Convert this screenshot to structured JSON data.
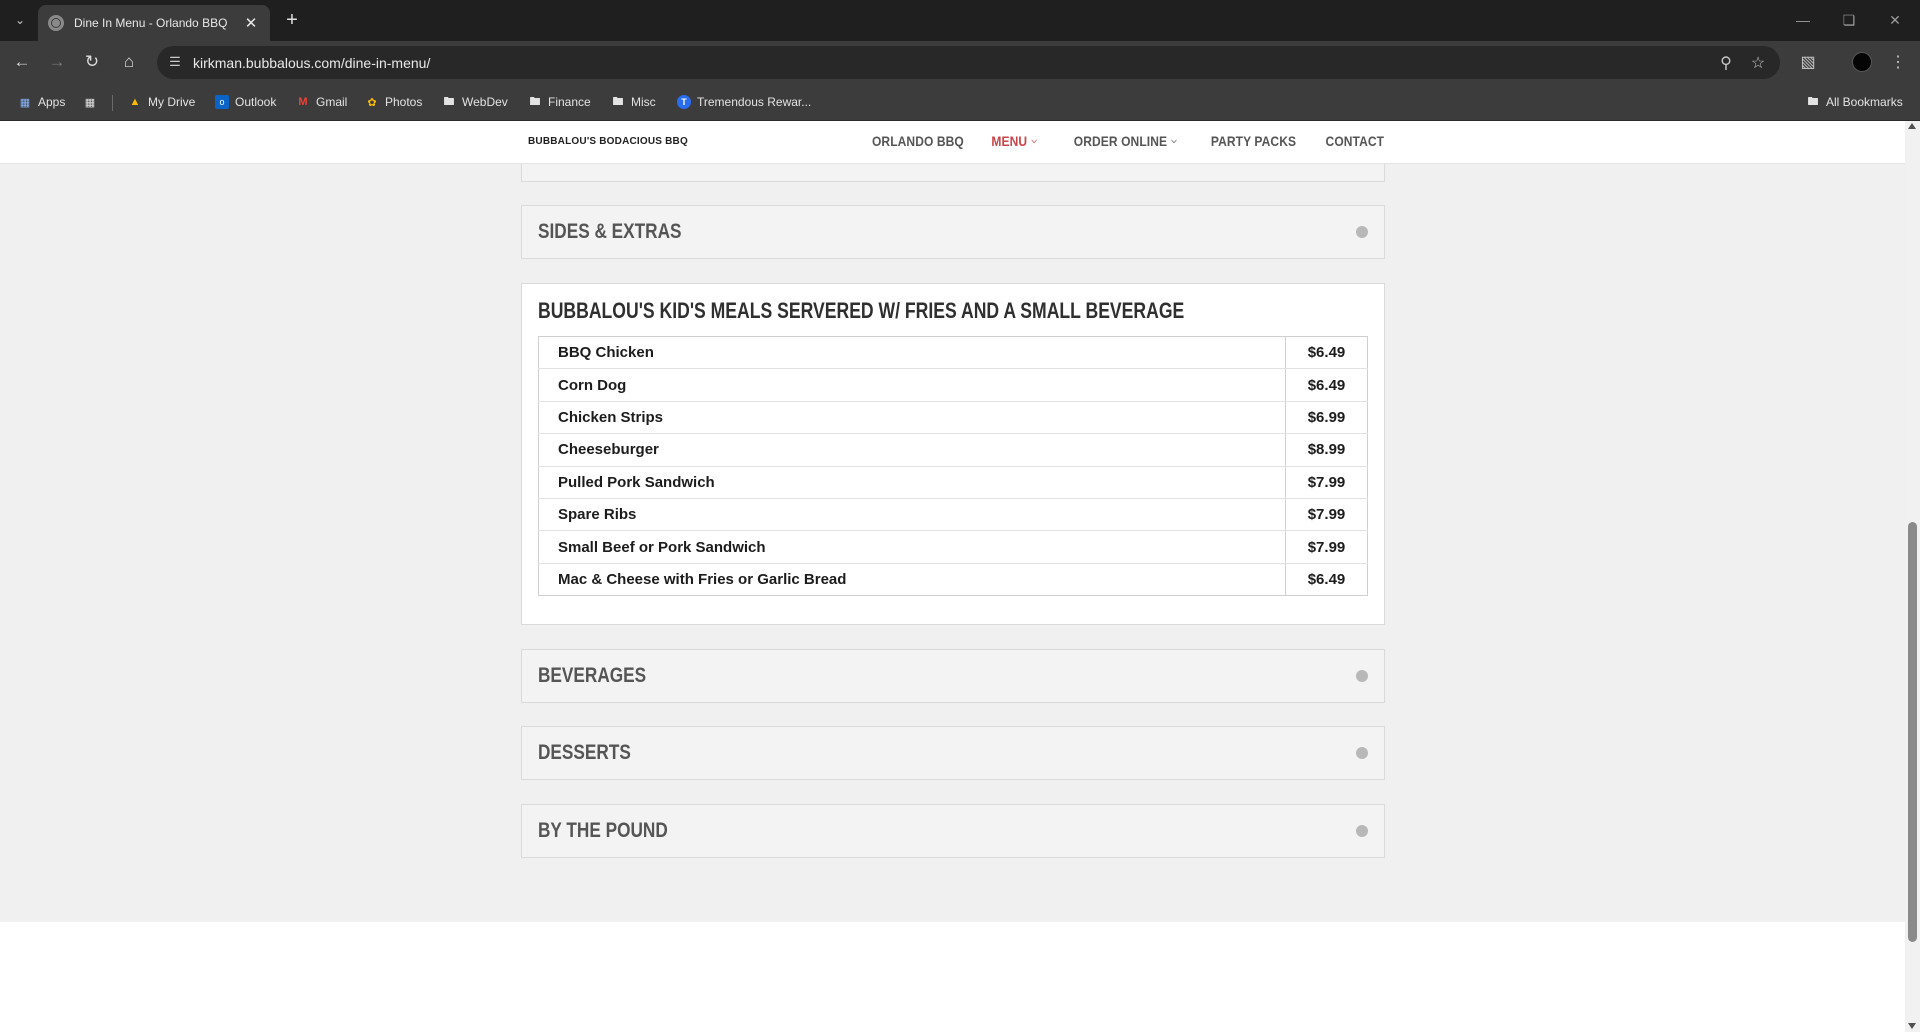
{
  "browser": {
    "tab_title": "Dine In Menu - Orlando BBQ",
    "url": "kirkman.bubbalous.com/dine-in-menu/",
    "bookmarks": [
      {
        "label": "Apps",
        "icon": "apps-grid-icon"
      },
      {
        "label": "",
        "icon": "grid-icon"
      },
      {
        "label": "My Drive",
        "icon": "drive-icon"
      },
      {
        "label": "Outlook",
        "icon": "outlook-icon"
      },
      {
        "label": "Gmail",
        "icon": "gmail-icon"
      },
      {
        "label": "Photos",
        "icon": "photos-icon"
      },
      {
        "label": "WebDev",
        "icon": "folder-icon"
      },
      {
        "label": "Finance",
        "icon": "folder-icon"
      },
      {
        "label": "Misc",
        "icon": "folder-icon"
      },
      {
        "label": "Tremendous Rewar...",
        "icon": "tremendous-icon"
      }
    ],
    "all_bookmarks": "All Bookmarks"
  },
  "site": {
    "logo": "BUBBALOU'S BODACIOUS BBQ",
    "nav": [
      "ORLANDO BBQ",
      "MENU",
      "ORDER ONLINE",
      "PARTY PACKS",
      "CONTACT"
    ],
    "active_nav": "MENU",
    "accent_color": "#c8454a"
  },
  "sections": {
    "sides": "SIDES & EXTRAS",
    "kids_title": "BUBBALOU'S KID'S MEALS SERVERED W/ FRIES AND A SMALL BEVERAGE",
    "beverages": "BEVERAGES",
    "desserts": "DESSERTS",
    "by_the_pound": "BY THE POUND"
  },
  "kids_menu": [
    {
      "item": "BBQ Chicken",
      "price": "$6.49"
    },
    {
      "item": "Corn Dog",
      "price": "$6.49"
    },
    {
      "item": "Chicken Strips",
      "price": "$6.99"
    },
    {
      "item": "Cheeseburger",
      "price": "$8.99"
    },
    {
      "item": "Pulled Pork Sandwich",
      "price": "$7.99"
    },
    {
      "item": "Spare Ribs",
      "price": "$7.99"
    },
    {
      "item": "Small Beef or Pork Sandwich",
      "price": "$7.99"
    },
    {
      "item": "Mac & Cheese with Fries or Garlic Bread",
      "price": "$6.49"
    }
  ]
}
